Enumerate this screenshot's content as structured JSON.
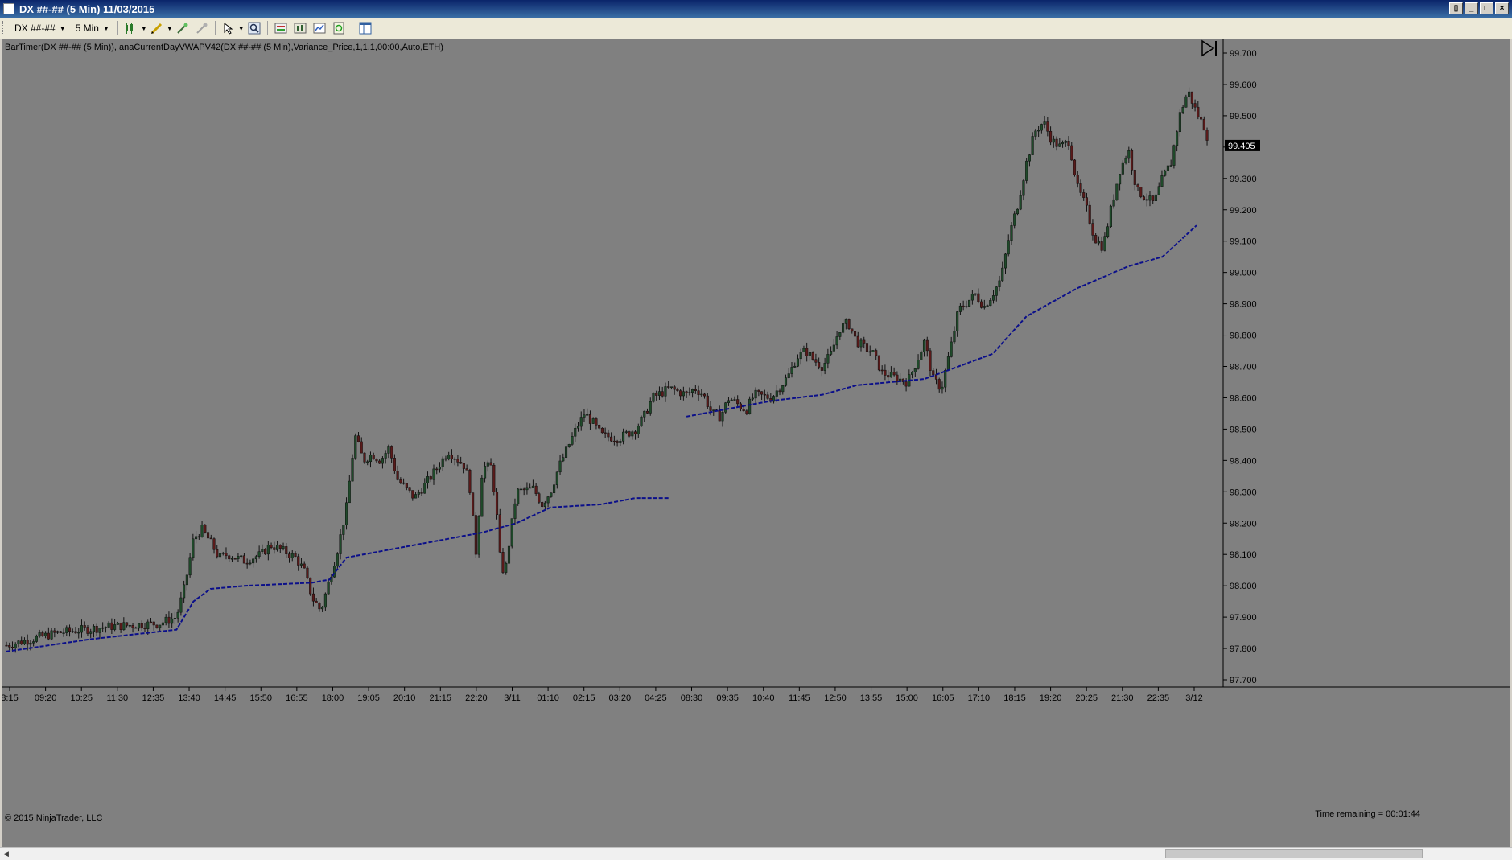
{
  "window": {
    "title": "DX ##-## (5 Min)  11/03/2015",
    "buttons": {
      "restore": "▯",
      "minimize": "_",
      "maximize": "□",
      "close": "×"
    }
  },
  "toolbar": {
    "instrument": "DX ##-##",
    "interval": "5 Min",
    "icons": [
      "candlestick-icon",
      "pencil-icon",
      "magic-wand-icon",
      "disabled-tool-icon",
      "cursor-icon",
      "zoom-icon",
      "strategy-icon",
      "indicator-icon",
      "chart-properties-icon",
      "refresh-icon",
      "layout-icon"
    ]
  },
  "chart_header": {
    "indicator_text": "BarTimer(DX ##-## (5 Min)), anaCurrentDayVWAPV42(DX ##-## (5 Min),Variance_Price,1,1,1,00:00,Auto,ETH)"
  },
  "footer": {
    "copyright": "© 2015 NinjaTrader, LLC",
    "time_remaining": "Time remaining = 00:01:44"
  },
  "colors": {
    "background": "#808080",
    "up_candle": "#1f4a2a",
    "down_candle": "#5a1a1a",
    "vwap": "#0b0f8a",
    "price_marker_bg": "#000000",
    "price_marker_fg": "#ffffff"
  },
  "chart_data": {
    "type": "candlestick",
    "y_ticks": [
      "99.700",
      "99.600",
      "99.500",
      "99.400",
      "99.300",
      "99.200",
      "99.100",
      "99.000",
      "98.900",
      "98.800",
      "98.700",
      "98.600",
      "98.500",
      "98.400",
      "98.300",
      "98.200",
      "98.100",
      "98.000",
      "97.900",
      "97.800",
      "97.700"
    ],
    "ylim": [
      97.7,
      99.7
    ],
    "x_ticks": [
      "8:15",
      "09:20",
      "10:25",
      "11:30",
      "12:35",
      "13:40",
      "14:45",
      "15:50",
      "16:55",
      "18:00",
      "19:05",
      "20:10",
      "21:15",
      "22:20",
      "3/11",
      "01:10",
      "02:15",
      "03:20",
      "04:25",
      "08:30",
      "09:35",
      "10:40",
      "11:45",
      "12:50",
      "13:55",
      "15:00",
      "16:05",
      "17:10",
      "18:15",
      "19:20",
      "20:25",
      "21:30",
      "22:35",
      "3/12"
    ],
    "last_price": "99.405",
    "price_path": [
      [
        0,
        97.81
      ],
      [
        3,
        97.85
      ],
      [
        6,
        97.87
      ],
      [
        9,
        97.88
      ],
      [
        10,
        97.9
      ],
      [
        10.5,
        98.0
      ],
      [
        11,
        98.15
      ],
      [
        11.5,
        98.18
      ],
      [
        12,
        98.14
      ],
      [
        12.5,
        98.09
      ],
      [
        13,
        98.1
      ],
      [
        14,
        98.08
      ],
      [
        15,
        98.1
      ],
      [
        15.5,
        98.13
      ],
      [
        16,
        98.12
      ],
      [
        17,
        98.09
      ],
      [
        17.5,
        98.05
      ],
      [
        18,
        97.96
      ],
      [
        18.5,
        97.92
      ],
      [
        19,
        98.02
      ],
      [
        19.5,
        98.12
      ],
      [
        20,
        98.25
      ],
      [
        20.5,
        98.48
      ],
      [
        21,
        98.4
      ],
      [
        21.5,
        98.42
      ],
      [
        22,
        98.4
      ],
      [
        22.5,
        98.44
      ],
      [
        23,
        98.34
      ],
      [
        24,
        98.28
      ],
      [
        25,
        98.35
      ],
      [
        26,
        98.43
      ],
      [
        27,
        98.38
      ],
      [
        27.3,
        98.3
      ],
      [
        27.6,
        98.1
      ],
      [
        28,
        98.38
      ],
      [
        28.5,
        98.38
      ],
      [
        28.8,
        98.26
      ],
      [
        29,
        98.1
      ],
      [
        29.3,
        98.03
      ],
      [
        29.6,
        98.15
      ],
      [
        30,
        98.3
      ],
      [
        31,
        98.31
      ],
      [
        31.5,
        98.26
      ],
      [
        32,
        98.3
      ],
      [
        32.5,
        98.38
      ],
      [
        33,
        98.44
      ],
      [
        33.5,
        98.5
      ],
      [
        34,
        98.55
      ],
      [
        34.5,
        98.52
      ],
      [
        35,
        98.48
      ],
      [
        36,
        98.47
      ],
      [
        37,
        98.5
      ],
      [
        37.5,
        98.54
      ],
      [
        38,
        98.6
      ],
      [
        39,
        98.63
      ],
      [
        40,
        98.61
      ],
      [
        40.5,
        98.63
      ],
      [
        41,
        98.61
      ],
      [
        41.5,
        98.55
      ],
      [
        42,
        98.54
      ],
      [
        42.5,
        98.6
      ],
      [
        43,
        98.58
      ],
      [
        43.5,
        98.56
      ],
      [
        44,
        98.61
      ],
      [
        45,
        98.6
      ],
      [
        46,
        98.67
      ],
      [
        46.5,
        98.73
      ],
      [
        47,
        98.75
      ],
      [
        47.5,
        98.72
      ],
      [
        48,
        98.7
      ],
      [
        48.5,
        98.74
      ],
      [
        49,
        98.82
      ],
      [
        49.5,
        98.84
      ],
      [
        50,
        98.78
      ],
      [
        51,
        98.74
      ],
      [
        51.5,
        98.68
      ],
      [
        52,
        98.67
      ],
      [
        52.5,
        98.66
      ],
      [
        53,
        98.65
      ],
      [
        53.5,
        98.71
      ],
      [
        54,
        98.78
      ],
      [
        54.5,
        98.66
      ],
      [
        55,
        98.63
      ],
      [
        55.5,
        98.75
      ],
      [
        56,
        98.88
      ],
      [
        57,
        98.93
      ],
      [
        57.5,
        98.89
      ],
      [
        58,
        98.93
      ],
      [
        58.5,
        98.98
      ],
      [
        59,
        99.12
      ],
      [
        59.5,
        99.22
      ],
      [
        60,
        99.35
      ],
      [
        60.5,
        99.45
      ],
      [
        61,
        99.48
      ],
      [
        61.5,
        99.42
      ],
      [
        62,
        99.4
      ],
      [
        62.5,
        99.42
      ],
      [
        63,
        99.27
      ],
      [
        63.5,
        99.21
      ],
      [
        64,
        99.11
      ],
      [
        64.5,
        99.08
      ],
      [
        65,
        99.21
      ],
      [
        65.5,
        99.33
      ],
      [
        66,
        99.39
      ],
      [
        66.5,
        99.26
      ],
      [
        67,
        99.24
      ],
      [
        67.5,
        99.22
      ],
      [
        68,
        99.3
      ],
      [
        68.5,
        99.35
      ],
      [
        69,
        99.5
      ],
      [
        69.5,
        99.58
      ],
      [
        70,
        99.51
      ],
      [
        70.5,
        99.46
      ],
      [
        70.8,
        99.4
      ]
    ],
    "vwap_path": [
      [
        0,
        97.79
      ],
      [
        5,
        97.83
      ],
      [
        10,
        97.86
      ],
      [
        11,
        97.95
      ],
      [
        12,
        97.99
      ],
      [
        14,
        98.0
      ],
      [
        18,
        98.01
      ],
      [
        19,
        98.02
      ],
      [
        20,
        98.09
      ],
      [
        22,
        98.11
      ],
      [
        25,
        98.14
      ],
      [
        28,
        98.17
      ],
      [
        30,
        98.2
      ],
      [
        32,
        98.25
      ],
      [
        35,
        98.26
      ],
      [
        37,
        98.28
      ],
      [
        39,
        98.28
      ],
      [
        39.01,
        null
      ],
      [
        40,
        98.54
      ],
      [
        42,
        98.56
      ],
      [
        45,
        98.59
      ],
      [
        48,
        98.61
      ],
      [
        50,
        98.64
      ],
      [
        54,
        98.66
      ],
      [
        56,
        98.7
      ],
      [
        58,
        98.74
      ],
      [
        60,
        98.86
      ],
      [
        61,
        98.89
      ],
      [
        63,
        98.95
      ],
      [
        66,
        99.02
      ],
      [
        68,
        99.05
      ],
      [
        70,
        99.15
      ]
    ]
  }
}
